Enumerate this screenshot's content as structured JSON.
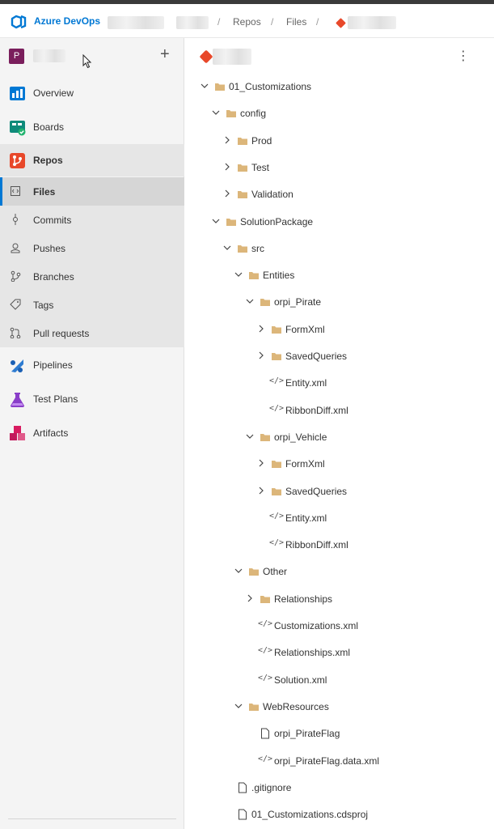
{
  "header": {
    "brand": "Azure DevOps",
    "breadcrumb": [
      "Repos",
      "Files"
    ],
    "separator": "/"
  },
  "sidebar": {
    "project_initial": "P",
    "add_glyph": "+",
    "items": [
      {
        "label": "Overview",
        "icon": "overview-icon"
      },
      {
        "label": "Boards",
        "icon": "boards-icon"
      },
      {
        "label": "Repos",
        "icon": "repos-icon"
      },
      {
        "label": "Files",
        "icon": "files-icon"
      },
      {
        "label": "Commits",
        "icon": "commits-icon"
      },
      {
        "label": "Pushes",
        "icon": "pushes-icon"
      },
      {
        "label": "Branches",
        "icon": "branches-icon"
      },
      {
        "label": "Tags",
        "icon": "tags-icon"
      },
      {
        "label": "Pull requests",
        "icon": "pull-requests-icon"
      },
      {
        "label": "Pipelines",
        "icon": "pipelines-icon"
      },
      {
        "label": "Test Plans",
        "icon": "test-plans-icon"
      },
      {
        "label": "Artifacts",
        "icon": "artifacts-icon"
      }
    ]
  },
  "main": {
    "more_glyph": "⋮",
    "tree": [
      {
        "name": "01_Customizations",
        "type": "folder",
        "depth": 0,
        "expanded": true
      },
      {
        "name": "config",
        "type": "folder",
        "depth": 1,
        "expanded": true
      },
      {
        "name": "Prod",
        "type": "folder",
        "depth": 2,
        "expanded": false
      },
      {
        "name": "Test",
        "type": "folder",
        "depth": 2,
        "expanded": false
      },
      {
        "name": "Validation",
        "type": "folder",
        "depth": 2,
        "expanded": false
      },
      {
        "name": "SolutionPackage",
        "type": "folder",
        "depth": 1,
        "expanded": true
      },
      {
        "name": "src",
        "type": "folder",
        "depth": 2,
        "expanded": true
      },
      {
        "name": "Entities",
        "type": "folder",
        "depth": 3,
        "expanded": true
      },
      {
        "name": "orpi_Pirate",
        "type": "folder",
        "depth": 4,
        "expanded": true
      },
      {
        "name": "FormXml",
        "type": "folder",
        "depth": 5,
        "expanded": false
      },
      {
        "name": "SavedQueries",
        "type": "folder",
        "depth": 5,
        "expanded": false
      },
      {
        "name": "Entity.xml",
        "type": "xml",
        "depth": 5
      },
      {
        "name": "RibbonDiff.xml",
        "type": "xml",
        "depth": 5
      },
      {
        "name": "orpi_Vehicle",
        "type": "folder",
        "depth": 4,
        "expanded": true
      },
      {
        "name": "FormXml",
        "type": "folder",
        "depth": 5,
        "expanded": false
      },
      {
        "name": "SavedQueries",
        "type": "folder",
        "depth": 5,
        "expanded": false
      },
      {
        "name": "Entity.xml",
        "type": "xml",
        "depth": 5
      },
      {
        "name": "RibbonDiff.xml",
        "type": "xml",
        "depth": 5
      },
      {
        "name": "Other",
        "type": "folder",
        "depth": 3,
        "expanded": true
      },
      {
        "name": "Relationships",
        "type": "folder",
        "depth": 4,
        "expanded": false
      },
      {
        "name": "Customizations.xml",
        "type": "xml",
        "depth": 4
      },
      {
        "name": "Relationships.xml",
        "type": "xml",
        "depth": 4
      },
      {
        "name": "Solution.xml",
        "type": "xml",
        "depth": 4
      },
      {
        "name": "WebResources",
        "type": "folder",
        "depth": 3,
        "expanded": true
      },
      {
        "name": "orpi_PirateFlag",
        "type": "file",
        "depth": 4
      },
      {
        "name": "orpi_PirateFlag.data.xml",
        "type": "xml",
        "depth": 4
      },
      {
        "name": ".gitignore",
        "type": "file",
        "depth": 2
      },
      {
        "name": "01_Customizations.cdsproj",
        "type": "file",
        "depth": 2
      }
    ]
  },
  "colors": {
    "accent": "#0078d4",
    "folder": "#dcb67a",
    "git": "#e8482a"
  }
}
